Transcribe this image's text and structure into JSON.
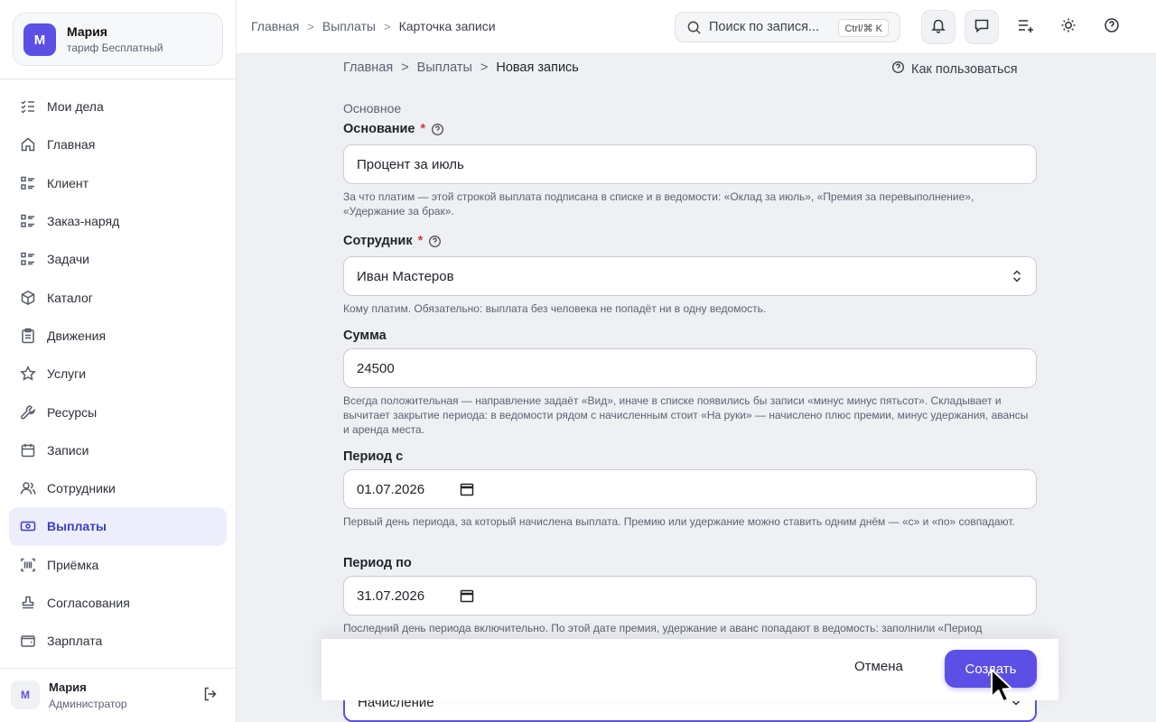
{
  "sidebar": {
    "user": {
      "initial": "М",
      "name": "Мария",
      "plan": "тариф Бесплатный"
    },
    "items": [
      {
        "label": "Мои дела",
        "icon": "list-check-icon"
      },
      {
        "label": "Главная",
        "icon": "home-icon"
      },
      {
        "label": "Клиент",
        "icon": "list-icon"
      },
      {
        "label": "Заказ-наряд",
        "icon": "list-icon"
      },
      {
        "label": "Задачи",
        "icon": "list-icon"
      },
      {
        "label": "Каталог",
        "icon": "box-icon"
      },
      {
        "label": "Движения",
        "icon": "clipboard-icon"
      },
      {
        "label": "Услуги",
        "icon": "star-icon"
      },
      {
        "label": "Ресурсы",
        "icon": "wrench-icon"
      },
      {
        "label": "Записи",
        "icon": "calendar-icon"
      },
      {
        "label": "Сотрудники",
        "icon": "users-icon"
      },
      {
        "label": "Выплаты",
        "icon": "banknote-icon",
        "active": true
      },
      {
        "label": "Приёмка",
        "icon": "barcode-icon"
      },
      {
        "label": "Согласования",
        "icon": "stamp-icon"
      },
      {
        "label": "Зарплата",
        "icon": "wallet-icon"
      }
    ],
    "footer": {
      "initial": "М",
      "name": "Мария",
      "role": "Администратор"
    }
  },
  "topbar": {
    "breadcrumbs": [
      "Главная",
      "Выплаты",
      "Карточка записи"
    ],
    "search_placeholder": "Поиск по запися...",
    "search_shortcut": "Ctrl/⌘ K"
  },
  "page": {
    "breadcrumbs": [
      "Главная",
      "Выплаты",
      "Новая запись"
    ],
    "howto": "Как пользоваться",
    "section": "Основное",
    "fields": {
      "basis": {
        "label": "Основание",
        "value": "Процент за июль",
        "hint": "За что платим — этой строкой выплата подписана в списке и в ведомости: «Оклад за июль», «Премия за перевыполнение», «Удержание за брак»."
      },
      "employee": {
        "label": "Сотрудник",
        "value": "Иван Мастеров",
        "hint": "Кому платим. Обязательно: выплата без человека не попадёт ни в одну ведомость."
      },
      "amount": {
        "label": "Сумма",
        "value": "24500",
        "hint": "Всегда положительная — направление задаёт «Вид», иначе в списке появились бы записи «минус минус пятьсот». Складывает и вычитает закрытие периода: в ведомости рядом с начисленным стоит «На руки» — начислено плюс премии, минус удержания, авансы и аренда места."
      },
      "period_from": {
        "label": "Период с",
        "value": "01.07.2026",
        "hint": "Первый день периода, за который начислена выплата. Премию или удержание можно ставить одним днём — «с» и «по» совпадают."
      },
      "period_to": {
        "label": "Период по",
        "value": "31.07.2026",
        "hint": "Последний день периода включительно. По этой дате премия, удержание и аванс попадают в ведомость: заполнили «Период"
      },
      "kind": {
        "value": "Начисление"
      }
    }
  },
  "actions": {
    "cancel": "Отмена",
    "create": "Создать"
  },
  "colors": {
    "accent": "#5b4fe6",
    "required": "#d63a3a"
  }
}
